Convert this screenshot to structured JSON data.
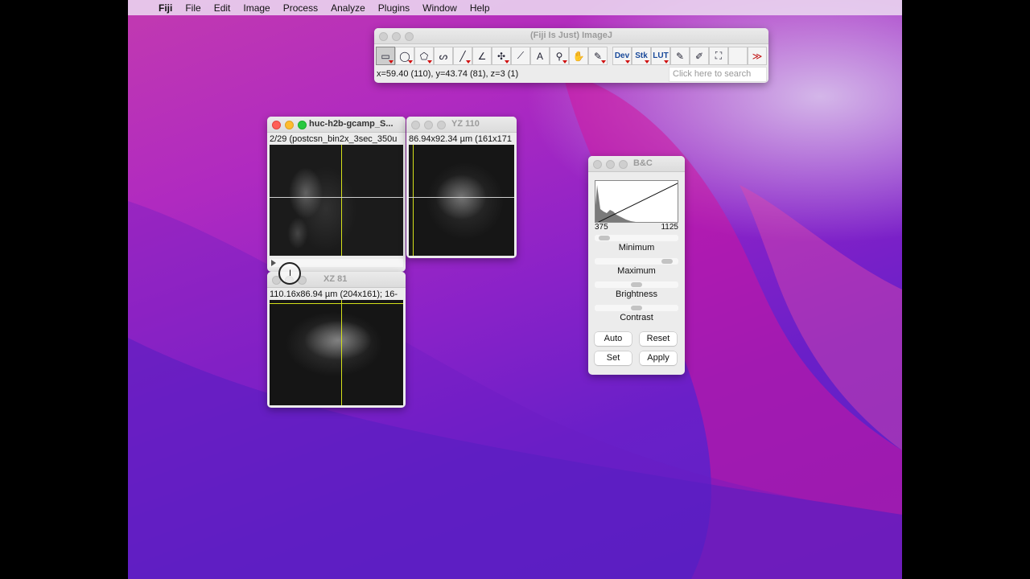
{
  "menubar": {
    "app": "Fiji",
    "items": [
      "File",
      "Edit",
      "Image",
      "Process",
      "Analyze",
      "Plugins",
      "Window",
      "Help"
    ]
  },
  "imagej": {
    "title": "(Fiji Is Just) ImageJ",
    "status": "x=59.40 (110), y=43.74 (81), z=3 (1)",
    "search_placeholder": "Click here to search",
    "tools": [
      {
        "name": "rectangle-tool-icon",
        "glyph": "▭"
      },
      {
        "name": "oval-tool-icon",
        "glyph": "◯"
      },
      {
        "name": "polygon-tool-icon",
        "glyph": "⬠"
      },
      {
        "name": "freehand-tool-icon",
        "glyph": "ᔕ"
      },
      {
        "name": "line-tool-icon",
        "glyph": "╱"
      },
      {
        "name": "angle-tool-icon",
        "glyph": "∠"
      },
      {
        "name": "point-tool-icon",
        "glyph": "✣"
      },
      {
        "name": "wand-tool-icon",
        "glyph": "⟋"
      },
      {
        "name": "text-tool-icon",
        "glyph": "A"
      },
      {
        "name": "magnifier-tool-icon",
        "glyph": "⚲"
      },
      {
        "name": "hand-tool-icon",
        "glyph": "✋"
      },
      {
        "name": "color-picker-tool-icon",
        "glyph": "✎"
      }
    ],
    "dev_label": "Dev",
    "stk_label": "Stk",
    "lut_label": "LUT",
    "more_glyph": "≫"
  },
  "main_image": {
    "title": "huc-h2b-gcamp_S...",
    "info": "2/29 (postcsn_bin2x_3sec_350u"
  },
  "yz_image": {
    "title": "YZ 110",
    "info": "86.94x92.34 µm (161x171"
  },
  "xz_image": {
    "title": "XZ 81",
    "info": "110.16x86.94 µm (204x161); 16-"
  },
  "bc": {
    "title": "B&C",
    "min_value": "375",
    "max_value": "1125",
    "minimum_label": "Minimum",
    "maximum_label": "Maximum",
    "brightness_label": "Brightness",
    "contrast_label": "Contrast",
    "auto_label": "Auto",
    "reset_label": "Reset",
    "set_label": "Set",
    "apply_label": "Apply",
    "minimum_level": 0.05,
    "maximum_level": 0.92,
    "brightness_level": 0.5,
    "contrast_level": 0.5
  }
}
